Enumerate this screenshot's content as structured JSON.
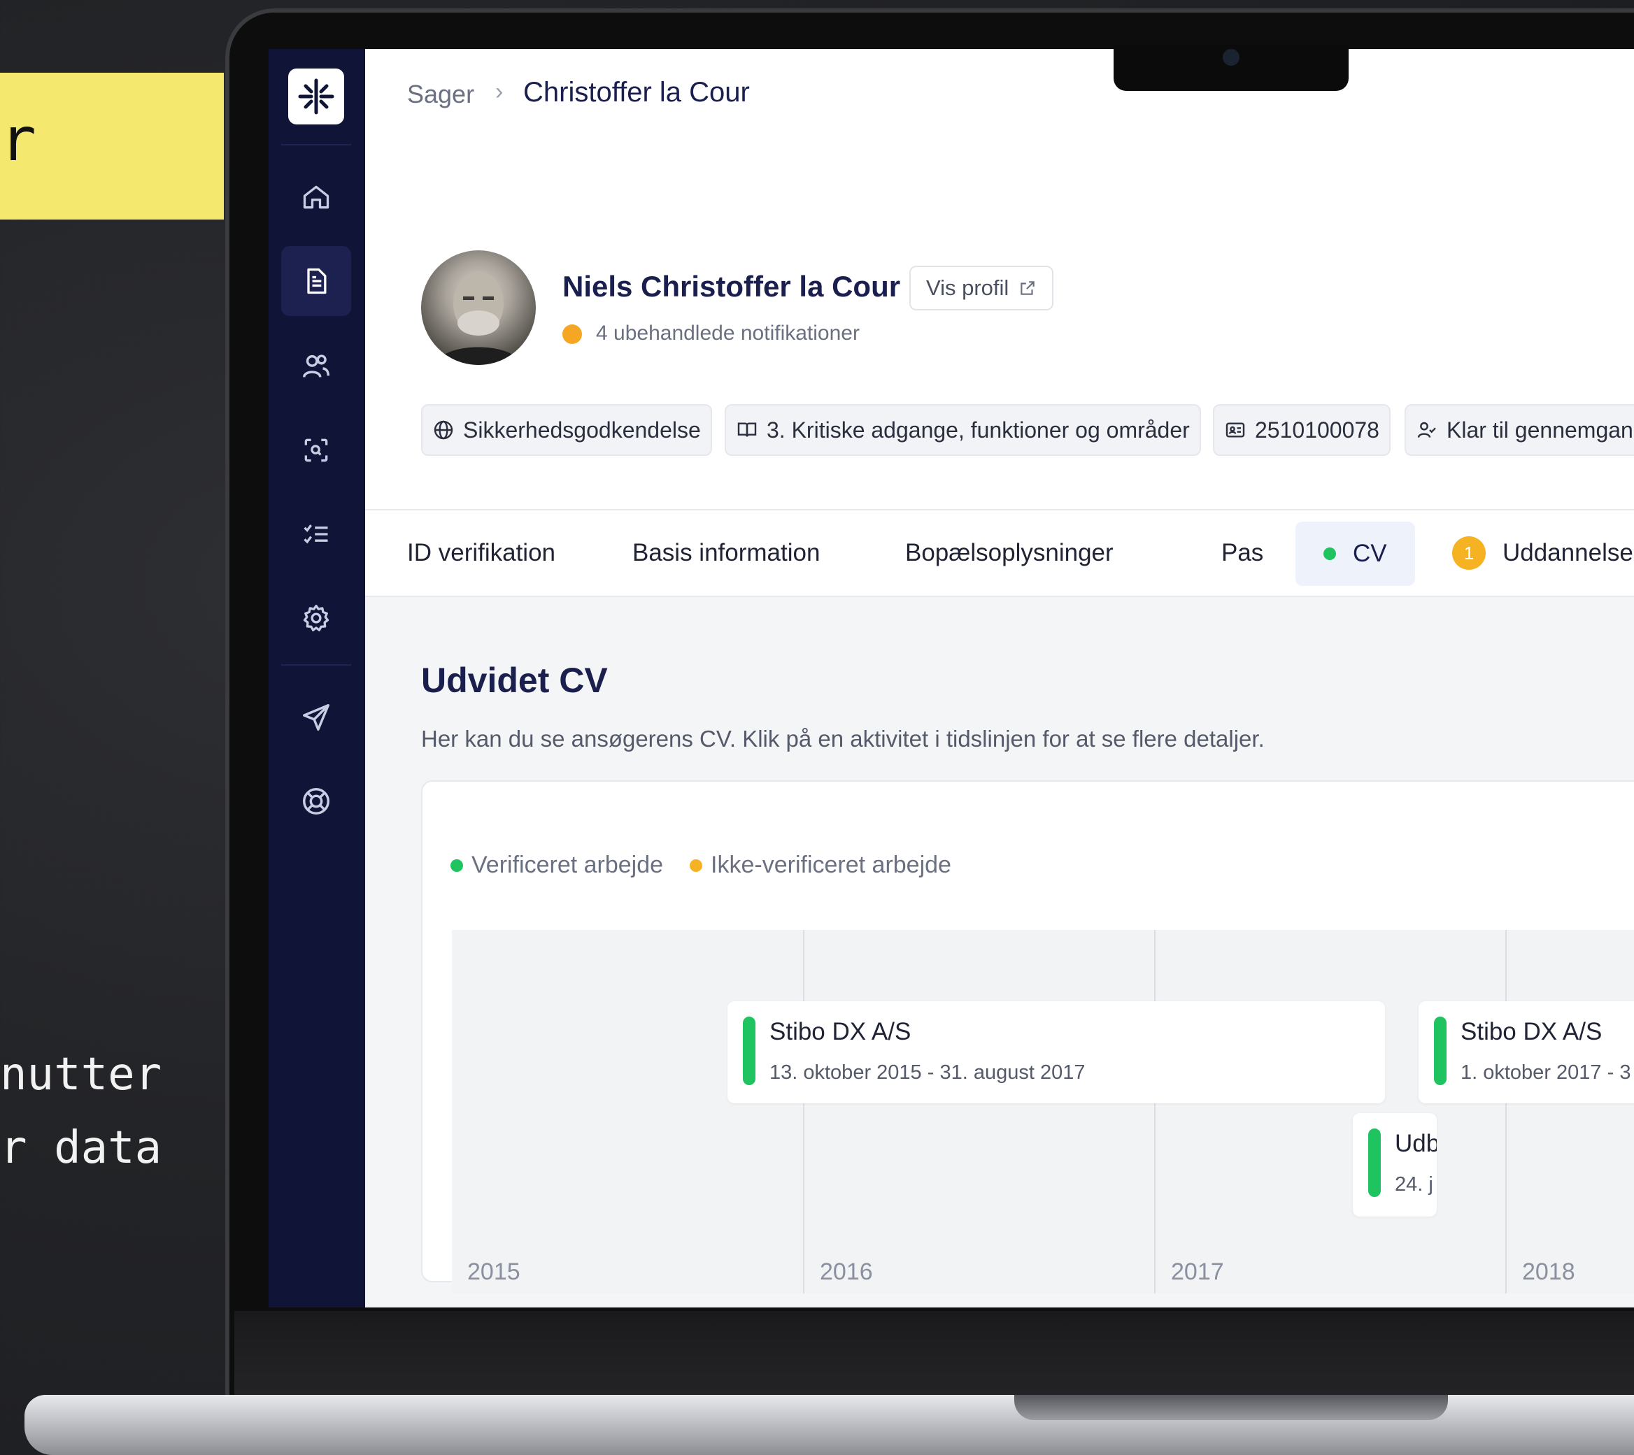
{
  "promo": {
    "yellow_text": "r",
    "line1": "nutter",
    "line2": "r data"
  },
  "breadcrumb": {
    "parent": "Sager",
    "current": "Christoffer la Cour"
  },
  "profile": {
    "name": "Niels Christoffer la Cour",
    "view_profile_label": "Vis profil",
    "notifications": "4 ubehandlede notifikationer"
  },
  "chips": [
    {
      "icon": "globe-icon",
      "label": "Sikkerhedsgodkendelse"
    },
    {
      "icon": "book-icon",
      "label": "3. Kritiske adgange, funktioner og områder"
    },
    {
      "icon": "id-card-icon",
      "label": "2510100078"
    },
    {
      "icon": "user-check-icon",
      "label": "Klar til gennemgang"
    }
  ],
  "tabs": [
    {
      "label": "ID verifikation"
    },
    {
      "label": "Basis information"
    },
    {
      "label": "Bopælsoplysninger"
    },
    {
      "label": "Pas"
    },
    {
      "label": "CV",
      "active": true
    },
    {
      "label": "Uddannelse",
      "badge": "1"
    }
  ],
  "cv": {
    "title": "Udvidet CV",
    "description": "Her kan du se ansøgerens CV. Klik på en aktivitet i tidslinjen for at se flere detaljer.",
    "legend": [
      {
        "label": "Verificeret arbejde",
        "color": "#1fc35f"
      },
      {
        "label": "Ikke-verificeret arbejde",
        "color": "#f5b323"
      }
    ],
    "years": [
      "2015",
      "2016",
      "2017",
      "2018"
    ],
    "entries": [
      {
        "title": "Stibo DX A/S",
        "date": "13. oktober 2015 - 31. august 2017",
        "status": "verified"
      },
      {
        "title": "Stibo DX A/S",
        "date": "1. oktober 2017 - 3",
        "status": "verified"
      },
      {
        "title": "Udb",
        "date": "24. j",
        "status": "verified"
      }
    ]
  },
  "colors": {
    "sidebar": "#101437",
    "accent_green": "#1fc35f",
    "accent_orange": "#f5a623",
    "navy_text": "#1a1f4e"
  }
}
